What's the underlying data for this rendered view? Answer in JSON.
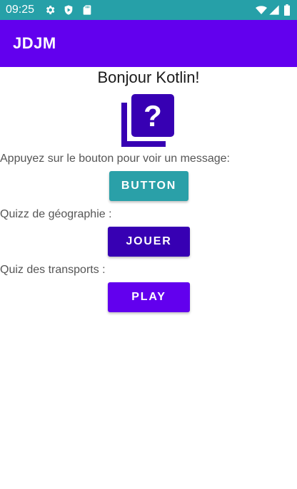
{
  "status_bar": {
    "time": "09:25",
    "icons": [
      "settings-icon",
      "shield-icon",
      "sd-card-icon",
      "wifi-icon",
      "signal-icon",
      "battery-icon"
    ],
    "color": "#26a0a8"
  },
  "app_bar": {
    "title": "JDJM",
    "color": "#6200ee"
  },
  "main": {
    "greeting": "Bonjour Kotlin!",
    "quiz_icon": "question-mark-stack-icon",
    "message_label": "Appuyez sur le bouton pour voir un message:",
    "message_button": "BUTTON",
    "geo_label": "Quizz de géographie :",
    "geo_button": "JOUER",
    "transport_label": "Quiz des transports :",
    "transport_button": "PLAY"
  },
  "colors": {
    "teal_button": "#2aa0a8",
    "dark_purple_button": "#3700b3",
    "purple_button": "#6200ee",
    "icon_color": "#3700b3"
  }
}
